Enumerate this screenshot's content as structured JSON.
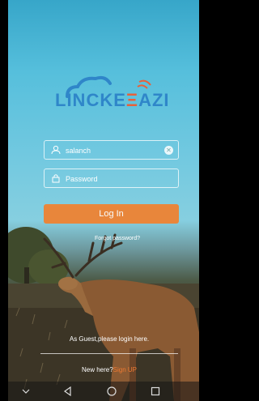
{
  "app": {
    "logo_text_part1": "LINCKE",
    "logo_text_part2": "AZI"
  },
  "login": {
    "username_value": "salanch",
    "password_placeholder": "Password",
    "login_button": "Log In",
    "forgot_password": "Forgot password?",
    "guest_text": "As Guest,please login here.",
    "new_here": "New here?",
    "sign_up": "Sign UP"
  },
  "colors": {
    "accent": "#ee8333",
    "logo_blue": "#2f86c9",
    "logo_orange": "#e8613a"
  },
  "icons": [
    "user-icon",
    "lock-icon",
    "clear-icon",
    "cloud-logo-icon",
    "back-icon",
    "home-icon",
    "recents-icon",
    "hide-keyboard-icon"
  ]
}
